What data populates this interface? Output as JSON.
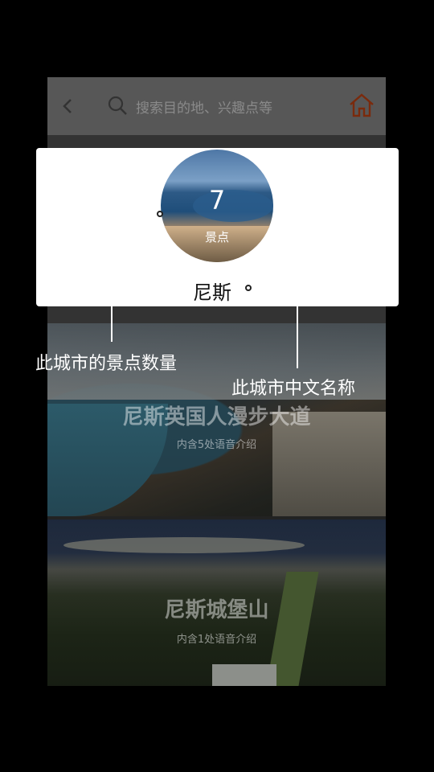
{
  "search": {
    "placeholder": "搜索目的地、兴趣点等"
  },
  "icons": {
    "back": "back-arrow-icon",
    "search": "search-icon",
    "home": "home-icon"
  },
  "city": {
    "name": "尼斯",
    "attraction_count": "7",
    "attraction_label": "景点"
  },
  "attractions": [
    {
      "title": "尼斯英国人漫步大道",
      "subtitle": "内含5处语音介绍"
    },
    {
      "title": "尼斯城堡山",
      "subtitle": "内含1处语音介绍"
    }
  ],
  "annotations": {
    "count_note": "此城市的景点数量",
    "name_note": "此城市中文名称"
  },
  "colors": {
    "accent": "#e05a1c",
    "overlay": "#000000"
  }
}
